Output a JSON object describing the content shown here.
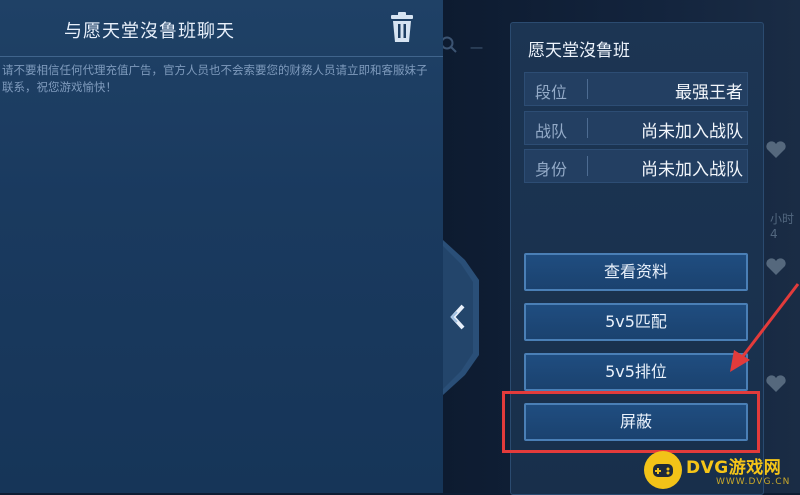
{
  "chat": {
    "title": "与愿天堂沒鲁班聊天",
    "notice": "请不要相信任何代理充值广告，官方人员也不会索要您的财務人员请立即和客服妹子联系，祝您游戏愉快！"
  },
  "background": {
    "search_placeholder": "一",
    "stub_text": "小时4"
  },
  "profile": {
    "name": "愿天堂沒鲁班",
    "rows": [
      {
        "label": "段位",
        "value": "最强王者"
      },
      {
        "label": "战队",
        "value": "尚未加入战队"
      },
      {
        "label": "身份",
        "value": "尚未加入战队"
      }
    ],
    "buttons": {
      "view_profile": "查看资料",
      "match_5v5": "5v5匹配",
      "ranked_5v5": "5v5排位",
      "block": "屏蔽"
    }
  },
  "colors": {
    "highlight": "#e23b3b",
    "accent": "#4a7fb6",
    "watermark": "#f5c518"
  },
  "watermark": {
    "brand": "DVG游戏网",
    "domain": "WWW.DVG.CN"
  },
  "icons": [
    "trash-icon",
    "search-icon",
    "collapse-arrow-icon",
    "heart-icon",
    "gamepad-icon",
    "annotation-arrow-icon"
  ]
}
